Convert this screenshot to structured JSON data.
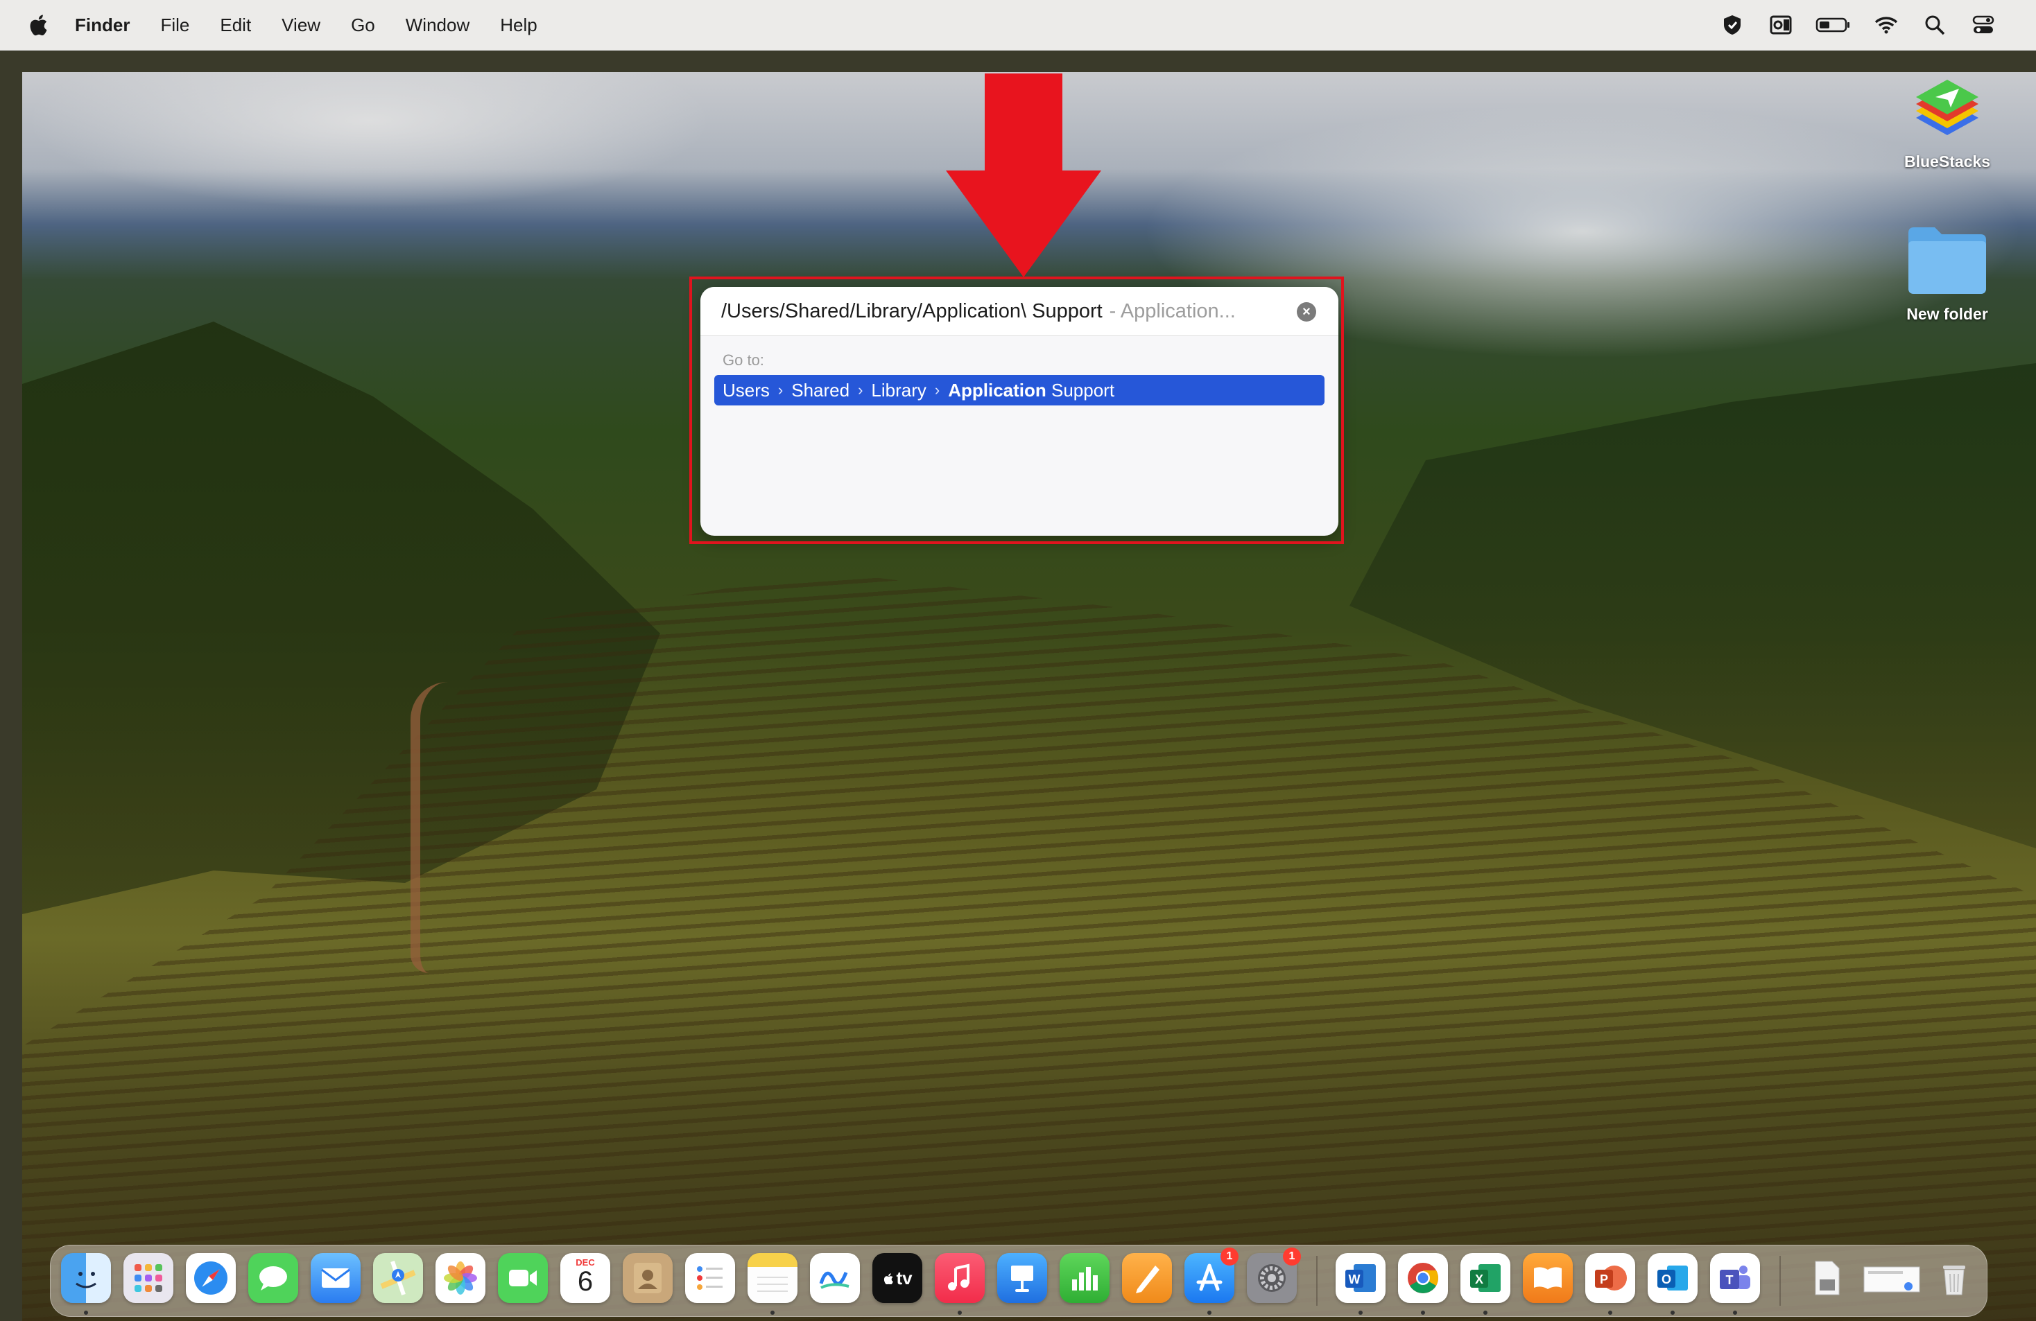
{
  "menubar": {
    "app_name": "Finder",
    "items": [
      "File",
      "Edit",
      "View",
      "Go",
      "Window",
      "Help"
    ],
    "status_icons": [
      "shield-status-icon",
      "outlook-status-icon",
      "battery-icon",
      "wifi-icon",
      "spotlight-search-icon",
      "control-center-icon"
    ]
  },
  "go_to_folder": {
    "path_value": "/Users/Shared/Library/Application\\ Support",
    "hint": "- Application...",
    "label": "Go to:",
    "result": {
      "crumbs": [
        "Users",
        "Shared",
        "Library"
      ],
      "final_bold": "Application",
      "final_rest": " Support",
      "highlight_color": "#2657d8"
    }
  },
  "annotation": {
    "arrow_color": "#e8141e",
    "box_color": "#e0141e"
  },
  "desktop_icons": [
    {
      "name": "BlueStacks"
    },
    {
      "name": "New folder"
    }
  ],
  "calendar": {
    "month": "DEC",
    "day": "6"
  },
  "dock": {
    "apps": [
      "Finder",
      "Launchpad",
      "Safari",
      "Messages",
      "Mail",
      "Maps",
      "Photos",
      "FaceTime",
      "Calendar",
      "Contacts",
      "Reminders",
      "Notes",
      "Freeform",
      "TV",
      "Music",
      "Keynote",
      "Numbers",
      "Pages",
      "App Store",
      "System Settings",
      "Word",
      "Chrome",
      "Excel",
      "Books",
      "PowerPoint",
      "Outlook",
      "Teams",
      "Document",
      "Image",
      "Trash"
    ],
    "tv_label": "tv",
    "badges": {
      "app_store": "1",
      "system_settings": "1"
    }
  }
}
